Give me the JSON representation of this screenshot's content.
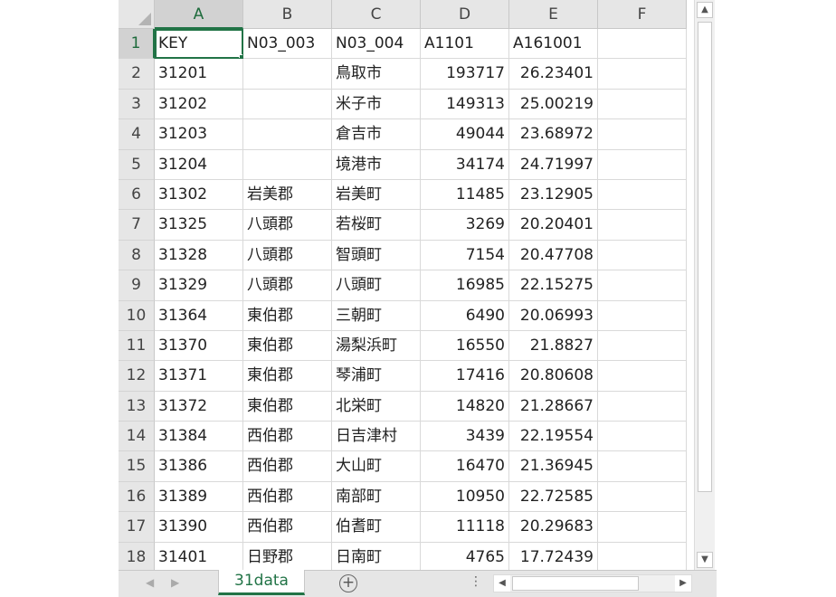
{
  "columns": [
    "A",
    "B",
    "C",
    "D",
    "E",
    "F"
  ],
  "rows": [
    {
      "n": "1",
      "cells": [
        "KEY",
        "N03_003",
        "N03_004",
        "A1101",
        "A161001",
        ""
      ]
    },
    {
      "n": "2",
      "cells": [
        "31201",
        "",
        "鳥取市",
        "193717",
        "26.23401",
        ""
      ]
    },
    {
      "n": "3",
      "cells": [
        "31202",
        "",
        "米子市",
        "149313",
        "25.00219",
        ""
      ]
    },
    {
      "n": "4",
      "cells": [
        "31203",
        "",
        "倉吉市",
        "49044",
        "23.68972",
        ""
      ]
    },
    {
      "n": "5",
      "cells": [
        "31204",
        "",
        "境港市",
        "34174",
        "24.71997",
        ""
      ]
    },
    {
      "n": "6",
      "cells": [
        "31302",
        "岩美郡",
        "岩美町",
        "11485",
        "23.12905",
        ""
      ]
    },
    {
      "n": "7",
      "cells": [
        "31325",
        "八頭郡",
        "若桜町",
        "3269",
        "20.20401",
        ""
      ]
    },
    {
      "n": "8",
      "cells": [
        "31328",
        "八頭郡",
        "智頭町",
        "7154",
        "20.47708",
        ""
      ]
    },
    {
      "n": "9",
      "cells": [
        "31329",
        "八頭郡",
        "八頭町",
        "16985",
        "22.15275",
        ""
      ]
    },
    {
      "n": "10",
      "cells": [
        "31364",
        "東伯郡",
        "三朝町",
        "6490",
        "20.06993",
        ""
      ]
    },
    {
      "n": "11",
      "cells": [
        "31370",
        "東伯郡",
        "湯梨浜町",
        "16550",
        "21.8827",
        ""
      ]
    },
    {
      "n": "12",
      "cells": [
        "31371",
        "東伯郡",
        "琴浦町",
        "17416",
        "20.80608",
        ""
      ]
    },
    {
      "n": "13",
      "cells": [
        "31372",
        "東伯郡",
        "北栄町",
        "14820",
        "21.28667",
        ""
      ]
    },
    {
      "n": "14",
      "cells": [
        "31384",
        "西伯郡",
        "日吉津村",
        "3439",
        "22.19554",
        ""
      ]
    },
    {
      "n": "15",
      "cells": [
        "31386",
        "西伯郡",
        "大山町",
        "16470",
        "21.36945",
        ""
      ]
    },
    {
      "n": "16",
      "cells": [
        "31389",
        "西伯郡",
        "南部町",
        "10950",
        "22.72585",
        ""
      ]
    },
    {
      "n": "17",
      "cells": [
        "31390",
        "西伯郡",
        "伯耆町",
        "11118",
        "20.29683",
        ""
      ]
    },
    {
      "n": "18",
      "cells": [
        "31401",
        "日野郡",
        "日南町",
        "4765",
        "17.72439",
        ""
      ]
    }
  ],
  "sheet_tab": "31data",
  "add_sheet_symbol": "+",
  "accent_color": "#217346"
}
